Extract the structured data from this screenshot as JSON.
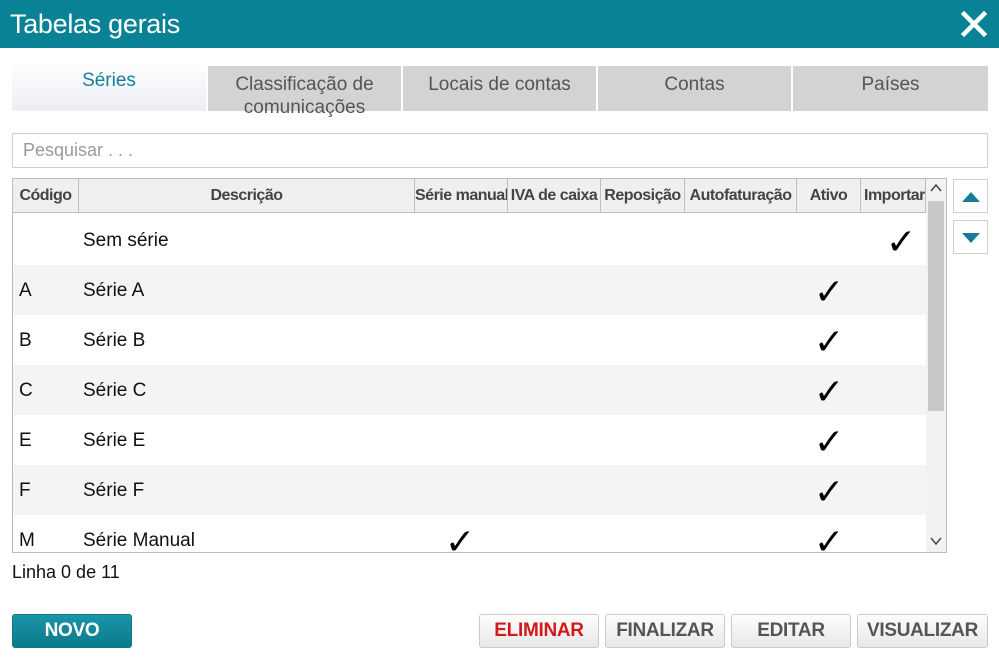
{
  "window": {
    "title": "Tabelas gerais"
  },
  "tabs": [
    {
      "label": "Séries",
      "active": true
    },
    {
      "label": "Classificação de comunicações",
      "line1": "Classificação de",
      "line2": "comunicações"
    },
    {
      "label": "Locais de contas"
    },
    {
      "label": "Contas"
    },
    {
      "label": "Países"
    }
  ],
  "search": {
    "placeholder": "Pesquisar . . .",
    "value": ""
  },
  "table": {
    "columns": [
      "Código",
      "Descrição",
      "Série manual",
      "IVA de caixa",
      "Reposição",
      "Autofaturação",
      "Ativo",
      "Importar"
    ],
    "rows": [
      {
        "code": "",
        "desc": "Sem série",
        "manual": false,
        "ativo": false,
        "importar": true
      },
      {
        "code": "A",
        "desc": "Série A",
        "manual": false,
        "ativo": true,
        "importar": false
      },
      {
        "code": "B",
        "desc": "Série B",
        "manual": false,
        "ativo": true,
        "importar": false
      },
      {
        "code": "C",
        "desc": "Série C",
        "manual": false,
        "ativo": true,
        "importar": false
      },
      {
        "code": "E",
        "desc": "Série E",
        "manual": false,
        "ativo": true,
        "importar": false
      },
      {
        "code": "F",
        "desc": "Série F",
        "manual": false,
        "ativo": true,
        "importar": false
      },
      {
        "code": "M",
        "desc": "Série Manual",
        "manual": true,
        "ativo": true,
        "importar": false
      }
    ]
  },
  "status": {
    "text": "Linha 0 de 11"
  },
  "buttons": {
    "novo": "NOVO",
    "eliminar": "ELIMINAR",
    "finalizar": "FINALIZAR",
    "editar": "EDITAR",
    "visualizar": "VISUALIZAR"
  },
  "colors": {
    "header": "#0a8295",
    "accent": "#14809a",
    "danger": "#d21a1a"
  },
  "icons": {
    "close": "close-icon",
    "up": "arrow-up-icon",
    "down": "arrow-down-icon",
    "check": "check-icon"
  }
}
